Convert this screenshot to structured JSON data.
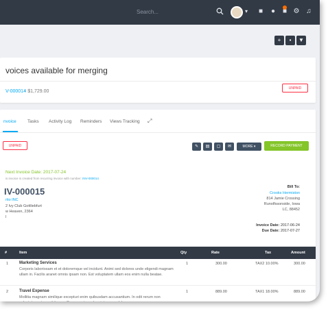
{
  "topbar": {
    "search_placeholder": "Search..."
  },
  "merge": {
    "title": "voices available for merging",
    "invoice_link": "V-000014",
    "amount": "- $1,729.00",
    "status": "UNPAID"
  },
  "tabs": [
    {
      "label": "nvoice",
      "active": true
    },
    {
      "label": "Tasks",
      "active": false
    },
    {
      "label": "Activity Log",
      "active": false
    },
    {
      "label": "Reminders",
      "active": false
    },
    {
      "label": "Views Tracking",
      "active": false
    }
  ],
  "invoice": {
    "status": "UNPAID",
    "more_label": "MORE",
    "record_payment_label": "RECORD PAYMENT",
    "next_invoice_date": "Next Invoice Date: 2017-07-24",
    "recurring_note": "is invoice is created from recurring invoice with number:",
    "recurring_link": "INV-000014",
    "number": "IV-000015",
    "company": {
      "name": "rtio INC",
      "lines": [
        "2 Ivy Club Gottliebfurt",
        "w Heaven, 2364",
        "l"
      ]
    },
    "bill_to": {
      "label": "Bill To:",
      "client": "Crooks Hermiston",
      "lines": [
        "814 Jamie Crossing",
        "Runolfssonside, Iowa",
        "LC, 88452"
      ]
    },
    "invoice_date": {
      "label": "Invoice Date:",
      "value": "2017-06-24"
    },
    "due_date": {
      "label": "Due Date:",
      "value": "2017-07-27"
    }
  },
  "table": {
    "headers": {
      "num": "#",
      "item": "Item",
      "qty": "Qty",
      "rate": "Rate",
      "tax": "Tax",
      "amount": "Amount"
    },
    "rows": [
      {
        "num": "1",
        "name": "Marketing Services",
        "description": "Corporis laboriosam et et doloremque vel incidunt. Animi sed dolores unde eligendi magnam ullam in. Facilis aranet omnis ipsam non. Est voluptatem ullam eos enim nulla beatae.",
        "qty": "1",
        "rate": "300.00",
        "tax": "TAX2 10.00%",
        "amount": "300.00"
      },
      {
        "num": "2",
        "name": "Travel Expense",
        "description": "Mollitia magnam similique excepturi enim quibusdam accusantium. In odit rerum non voluptatem atque sit itaque. Consequatur vel pariatur qua, dolore",
        "qty": "1",
        "rate": "889.00",
        "tax": "TAX1 18.00%",
        "amount": "889.00"
      }
    ]
  }
}
